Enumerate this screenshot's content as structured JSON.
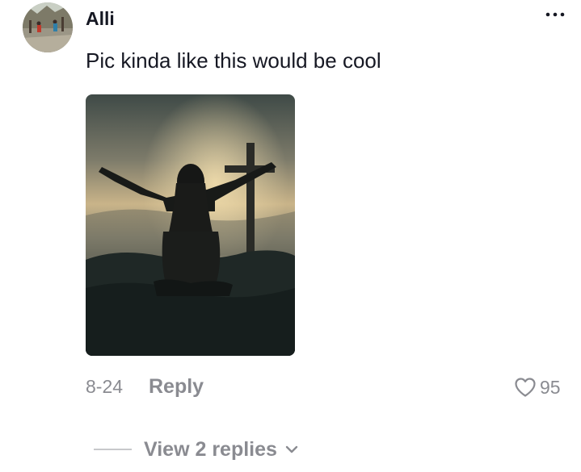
{
  "comment": {
    "username": "Alli",
    "text": "Pic kinda like this would be cool",
    "date": "8-24",
    "reply_label": "Reply",
    "like_count": "95",
    "view_replies_label": "View 2 replies"
  },
  "icons": {
    "more": "more-horizontal-icon",
    "like": "heart-outline-icon",
    "expand": "chevron-down-icon"
  },
  "colors": {
    "text_primary": "#161823",
    "text_secondary": "#8a8b91"
  }
}
